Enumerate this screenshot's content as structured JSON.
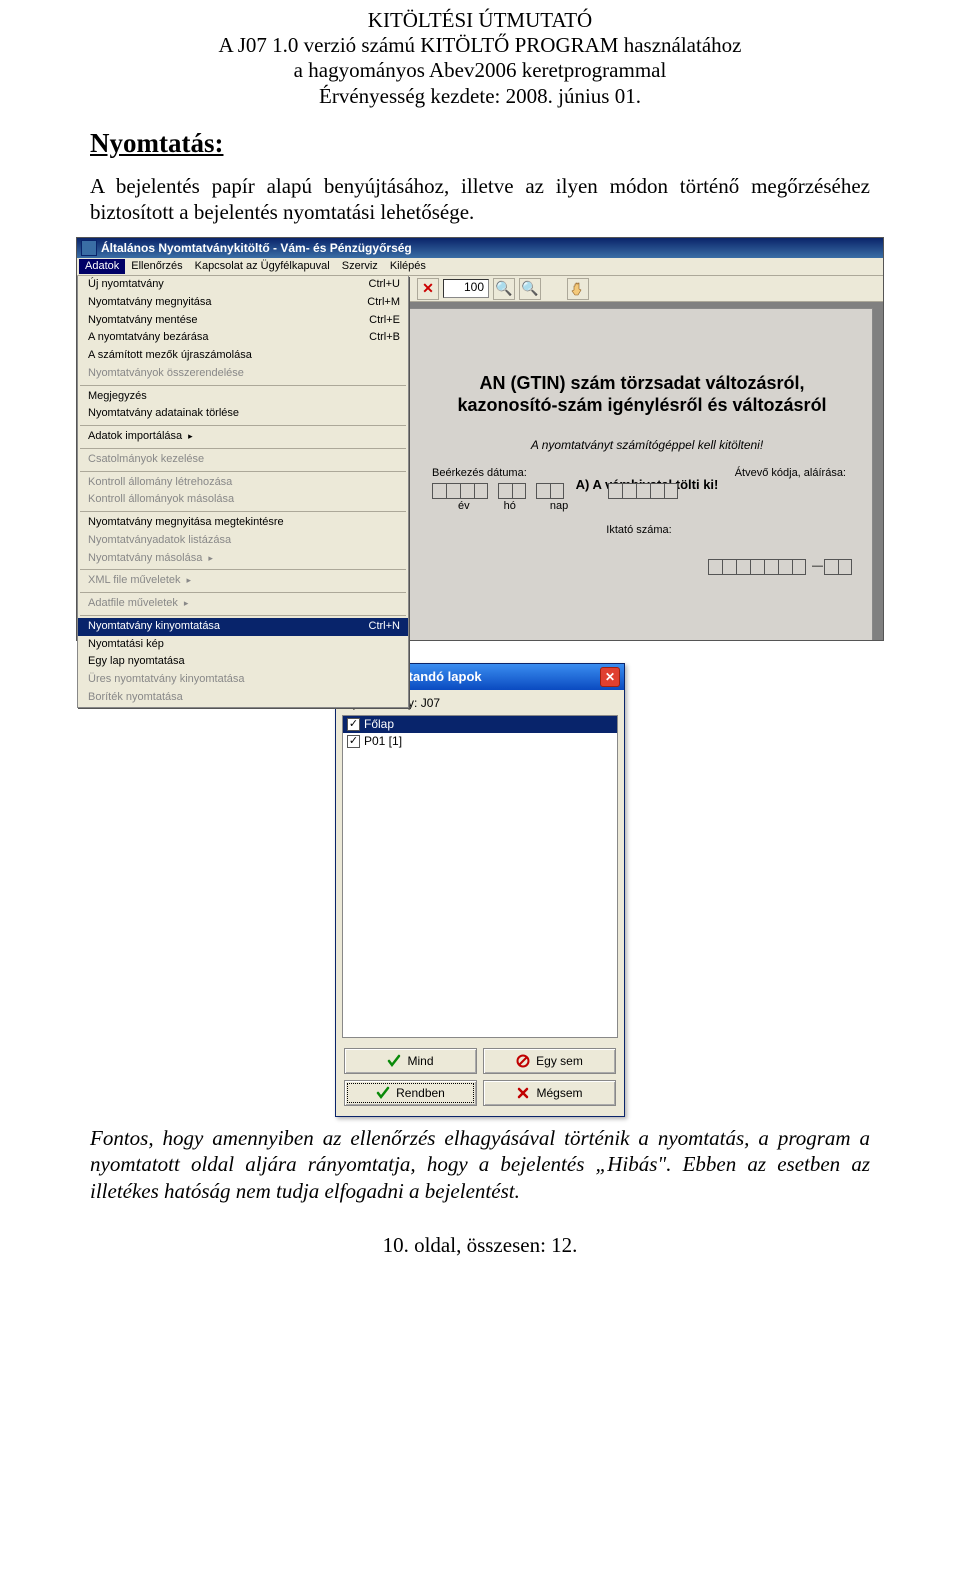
{
  "page_header": {
    "line1": "KITÖLTÉSI ÚTMUTATÓ",
    "line2": "A J07 1.0 verzió számú KITÖLTŐ PROGRAM használatához",
    "line3": "a hagyományos Abev2006 keretprogrammal",
    "line4": "Érvényesség kezdete: 2008. június 01."
  },
  "section_title": "Nyomtatás:",
  "intro": "A bejelentés papír alapú benyújtásához, illetve az ilyen módon történő megőrzéséhez biztosított a bejelentés nyomtatási lehetősége.",
  "app1": {
    "title": "Általános Nyomtatványkitöltő - Vám- és Pénzügyőrség",
    "menubar": [
      "Adatok",
      "Ellenőrzés",
      "Kapcsolat az Ügyfélkapuval",
      "Szerviz",
      "Kilépés"
    ],
    "menubar_selected": 0,
    "zoom": "100",
    "menu": [
      {
        "label": "Új nyomtatvány",
        "shortcut": "Ctrl+U"
      },
      {
        "label": "Nyomtatvány megnyitása",
        "shortcut": "Ctrl+M"
      },
      {
        "label": "Nyomtatvány mentése",
        "shortcut": "Ctrl+E"
      },
      {
        "label": "A nyomtatvány bezárása",
        "shortcut": "Ctrl+B"
      },
      {
        "label": "A számított mezők újraszámolása"
      },
      {
        "label": "Nyomtatványok összerendelése",
        "disabled": true
      },
      {
        "sep": true
      },
      {
        "label": "Megjegyzés"
      },
      {
        "label": "Nyomtatvány adatainak törlése"
      },
      {
        "sep": true
      },
      {
        "label": "Adatok importálása",
        "arrow": true
      },
      {
        "sep": true
      },
      {
        "label": "Csatolmányok kezelése",
        "disabled": true
      },
      {
        "sep": true
      },
      {
        "label": "Kontroll állomány létrehozása",
        "disabled": true
      },
      {
        "label": "Kontroll állományok másolása",
        "disabled": true
      },
      {
        "sep": true
      },
      {
        "label": "Nyomtatvány megnyitása megtekintésre"
      },
      {
        "label": "Nyomtatványadatok listázása",
        "disabled": true
      },
      {
        "label": "Nyomtatvány másolása",
        "disabled": true,
        "arrow": true
      },
      {
        "sep": true
      },
      {
        "label": "XML file műveletek",
        "disabled": true,
        "arrow": true
      },
      {
        "sep": true
      },
      {
        "label": "Adatfile műveletek",
        "disabled": true,
        "arrow": true
      },
      {
        "sep": true
      },
      {
        "label": "Nyomtatvány kinyomtatása",
        "shortcut": "Ctrl+N",
        "selected": true
      },
      {
        "label": "Nyomtatási kép"
      },
      {
        "label": "Egy lap nyomtatása"
      },
      {
        "label": "Üres nyomtatvány kinyomtatása",
        "disabled": true
      },
      {
        "label": "Boríték nyomtatása",
        "disabled": true
      }
    ],
    "page": {
      "title1": "AN (GTIN) szám törzsadat változásról,",
      "title2": "kazonosító-szám igénylésről és változásról",
      "note": "A nyomtatványt számítógéppel kell kitölteni!",
      "sectionA": "A) A vámhivatal tölti ki!",
      "beerk": "Beérkezés dátuma:",
      "atvevo": "Átvevő kódja, aláírása:",
      "ev": "év",
      "ho": "hó",
      "nap": "nap",
      "iktato": "Iktató száma:"
    }
  },
  "dialog": {
    "title": "Nyomtatandó lapok",
    "label_prefix": "Nyomtatvány:",
    "doc": "J07",
    "items": [
      {
        "label": "Főlap",
        "checked": true,
        "selected": true
      },
      {
        "label": "P01  [1]",
        "checked": true
      }
    ],
    "buttons": {
      "all": "Mind",
      "none": "Egy sem",
      "ok": "Rendben",
      "cancel": "Mégsem"
    }
  },
  "bottom_para": "Fontos, hogy amennyiben az ellenőrzés elhagyásával történik a nyomtatás, a program a nyomtatott oldal aljára rányomtatja, hogy a bejelentés „Hibás\". Ebben az esetben az illetékes hatóság nem tudja elfogadni a bejelentést.",
  "footer": "10. oldal, összesen: 12."
}
